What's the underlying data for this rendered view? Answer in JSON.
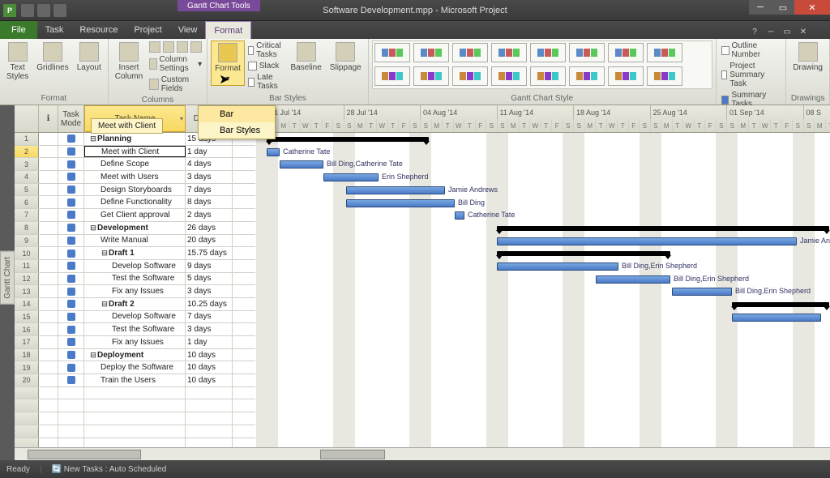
{
  "window": {
    "app_icon": "P",
    "tool_tab": "Gantt Chart Tools",
    "title": "Software Development.mpp - Microsoft Project"
  },
  "tabs": {
    "file": "File",
    "items": [
      "Task",
      "Resource",
      "Project",
      "View",
      "Format"
    ],
    "active": "Format"
  },
  "ribbon": {
    "groups": {
      "format": {
        "label": "Format",
        "text_styles": "Text\nStyles",
        "gridlines": "Gridlines",
        "layout": "Layout"
      },
      "columns": {
        "label": "Columns",
        "insert": "Insert\nColumn",
        "settings": "Column Settings",
        "custom": "Custom Fields"
      },
      "barstyles": {
        "label": "Bar Styles",
        "format_btn": "Format",
        "critical": "Critical Tasks",
        "slack": "Slack",
        "late": "Late Tasks",
        "baseline": "Baseline",
        "slippage": "Slippage"
      },
      "style": {
        "label": "Gantt Chart Style"
      },
      "showhide": {
        "label": "Show/Hide",
        "outline": "Outline Number",
        "project_summary": "Project Summary Task",
        "summary": "Summary Tasks"
      },
      "drawings": {
        "label": "Drawings",
        "drawing": "Drawing"
      }
    },
    "dropdown": {
      "bar": "Bar",
      "bar_styles": "Bar Styles"
    },
    "tooltip": "Meet with Client"
  },
  "table": {
    "headers": {
      "info": "ℹ",
      "mode": "Task\nMode",
      "name": "Task Name",
      "duration": "Duration"
    },
    "rows": [
      {
        "id": 1,
        "indent": 0,
        "summary": true,
        "name": "Planning",
        "dur": "15 days"
      },
      {
        "id": 2,
        "indent": 1,
        "summary": false,
        "name": "Meet with Client",
        "dur": "1 day",
        "selected": true
      },
      {
        "id": 3,
        "indent": 1,
        "summary": false,
        "name": "Define Scope",
        "dur": "4 days"
      },
      {
        "id": 4,
        "indent": 1,
        "summary": false,
        "name": "Meet with Users",
        "dur": "3 days"
      },
      {
        "id": 5,
        "indent": 1,
        "summary": false,
        "name": "Design Storyboards",
        "dur": "7 days"
      },
      {
        "id": 6,
        "indent": 1,
        "summary": false,
        "name": "Define Functionality",
        "dur": "8 days"
      },
      {
        "id": 7,
        "indent": 1,
        "summary": false,
        "name": "Get Client approval",
        "dur": "2 days"
      },
      {
        "id": 8,
        "indent": 0,
        "summary": true,
        "name": "Development",
        "dur": "26 days"
      },
      {
        "id": 9,
        "indent": 1,
        "summary": false,
        "name": "Write Manual",
        "dur": "20 days"
      },
      {
        "id": 10,
        "indent": 1,
        "summary": true,
        "name": "Draft 1",
        "dur": "15.75 days"
      },
      {
        "id": 11,
        "indent": 2,
        "summary": false,
        "name": "Develop Software",
        "dur": "9 days"
      },
      {
        "id": 12,
        "indent": 2,
        "summary": false,
        "name": "Test the Software",
        "dur": "5 days"
      },
      {
        "id": 13,
        "indent": 2,
        "summary": false,
        "name": "Fix any Issues",
        "dur": "3 days"
      },
      {
        "id": 14,
        "indent": 1,
        "summary": true,
        "name": "Draft 2",
        "dur": "10.25 days"
      },
      {
        "id": 15,
        "indent": 2,
        "summary": false,
        "name": "Develop Software",
        "dur": "7 days"
      },
      {
        "id": 16,
        "indent": 2,
        "summary": false,
        "name": "Test the Software",
        "dur": "3 days"
      },
      {
        "id": 17,
        "indent": 2,
        "summary": false,
        "name": "Fix any Issues",
        "dur": "1 day"
      },
      {
        "id": 18,
        "indent": 0,
        "summary": true,
        "name": "Deployment",
        "dur": "10 days"
      },
      {
        "id": 19,
        "indent": 1,
        "summary": false,
        "name": "Deploy the Software",
        "dur": "10 days"
      },
      {
        "id": 20,
        "indent": 1,
        "summary": false,
        "name": "Train the Users",
        "dur": "10 days"
      }
    ]
  },
  "timeline": {
    "weeks": [
      "21 Jul '14",
      "28 Jul '14",
      "04 Aug '14",
      "11 Aug '14",
      "18 Aug '14",
      "25 Aug '14",
      "01 Sep '14",
      "08 S"
    ],
    "days": [
      "S",
      "M",
      "T",
      "W",
      "T",
      "F",
      "S"
    ],
    "bars": [
      {
        "row": 0,
        "type": "summary",
        "start": 0,
        "len": 200
      },
      {
        "row": 1,
        "type": "task",
        "start": 0,
        "len": 16,
        "label": "Catherine Tate"
      },
      {
        "row": 2,
        "type": "task",
        "start": 16,
        "len": 54,
        "label": "Bill Ding,Catherine Tate"
      },
      {
        "row": 3,
        "type": "task",
        "start": 70,
        "len": 68,
        "label": "Erin Shepherd"
      },
      {
        "row": 4,
        "type": "task",
        "start": 98,
        "len": 122,
        "label": "Jamie Andrews"
      },
      {
        "row": 5,
        "type": "task",
        "start": 98,
        "len": 134,
        "label": "Bill Ding"
      },
      {
        "row": 6,
        "type": "task",
        "start": 232,
        "len": 12,
        "label": "Catherine Tate"
      },
      {
        "row": 7,
        "type": "summary",
        "start": 284,
        "len": 410
      },
      {
        "row": 8,
        "type": "task",
        "start": 284,
        "len": 370,
        "label": "Jamie And"
      },
      {
        "row": 9,
        "type": "summary",
        "start": 284,
        "len": 214
      },
      {
        "row": 10,
        "type": "task",
        "start": 284,
        "len": 150,
        "label": "Bill Ding,Erin Shepherd"
      },
      {
        "row": 11,
        "type": "task",
        "start": 406,
        "len": 92,
        "label": "Bill Ding,Erin Shepherd"
      },
      {
        "row": 12,
        "type": "task",
        "start": 500,
        "len": 74,
        "label": "Bill Ding,Erin Shepherd"
      },
      {
        "row": 13,
        "type": "summary",
        "start": 574,
        "len": 120
      },
      {
        "row": 14,
        "type": "task",
        "start": 574,
        "len": 110
      }
    ]
  },
  "sidebar_label": "Gantt Chart",
  "status": {
    "ready": "Ready",
    "mode": "New Tasks : Auto Scheduled"
  }
}
